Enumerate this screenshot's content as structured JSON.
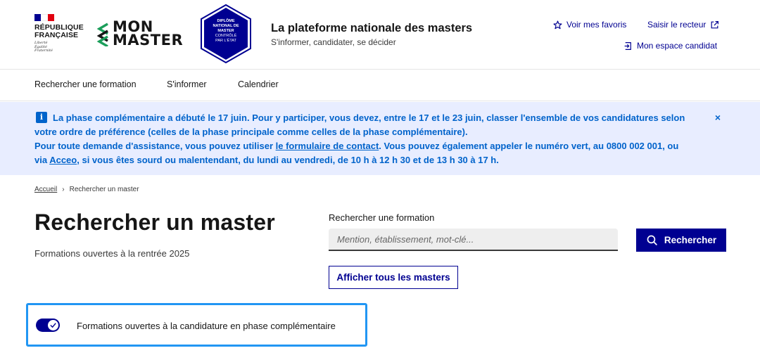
{
  "header": {
    "republic_lines": [
      "RÉPUBLIQUE",
      "FRANÇAISE"
    ],
    "motto_lines": [
      "Liberté",
      "Égalité",
      "Fraternité"
    ],
    "logo_lines": [
      "MON",
      "MASTER"
    ],
    "badge_lines": [
      "DIPLÔME",
      "NATIONAL DE",
      "MASTER",
      "CONTRÔLÉ",
      "PAR L'ÉTAT"
    ],
    "site_title": "La plateforme nationale des masters",
    "site_subtitle": "S'informer, candidater, se décider",
    "links": {
      "favorites": "Voir mes favoris",
      "rector": "Saisir le recteur",
      "candidate_space": "Mon espace candidat"
    },
    "icons": {
      "favorites": "star-icon",
      "rector": "external-link-icon",
      "candidate_space": "login-icon"
    }
  },
  "nav": {
    "items": [
      "Rechercher une formation",
      "S'informer",
      "Calendrier"
    ]
  },
  "notice": {
    "line1": "La phase complémentaire a débuté le 17 juin. Pour y participer, vous devez, entre le 17 et le 23 juin, classer l'ensemble de vos candidatures selon",
    "line2": "votre ordre de préférence (celles de la phase principale comme celles de la phase complémentaire).",
    "line3_a": "Pour toute demande d'assistance, vous pouvez utiliser ",
    "line3_link": "le formulaire de contact",
    "line3_b": ". Vous pouvez également appeler le numéro vert, au 0800 002 001, ou",
    "line4_a": "via ",
    "line4_link": "Acceo",
    "line4_b": ", si vous êtes sourd ou malentendant, du lundi au vendredi, de 10 h à 12 h 30 et de 13 h 30 à 17 h.",
    "close": "×",
    "info_glyph": "i"
  },
  "breadcrumb": {
    "home": "Accueil",
    "separator": "›",
    "current": "Rechercher un master"
  },
  "main": {
    "title": "Rechercher un master",
    "subtitle": "Formations ouvertes à la rentrée 2025"
  },
  "search": {
    "label": "Rechercher une formation",
    "placeholder": "Mention, établissement, mot-clé...",
    "button": "Rechercher",
    "all_button": "Afficher tous les masters"
  },
  "toggle": {
    "label": "Formations ouvertes à la candidature en phase complémentaire",
    "checked": true
  },
  "colors": {
    "primary": "#000091",
    "info": "#0063cb",
    "notice_bg": "#e8edff",
    "focus": "#2196f3"
  }
}
